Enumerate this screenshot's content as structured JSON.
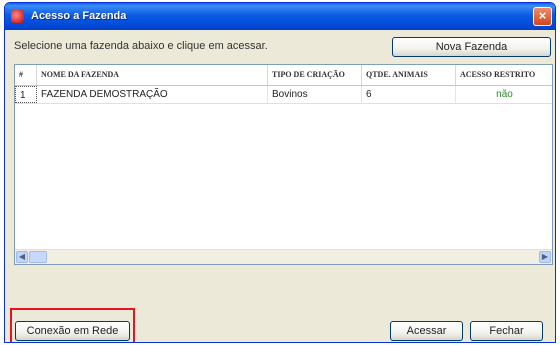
{
  "window": {
    "title": "Acesso a Fazenda",
    "close_label": "×"
  },
  "main": {
    "instruction": "Selecione uma fazenda abaixo e clique em acessar.",
    "new_farm_button": "Nova Fazenda"
  },
  "table": {
    "headers": [
      "#",
      "NOME DA FAZENDA",
      "TIPO DE CRIAÇÃO",
      "QTDE. ANIMAIS",
      "ACESSO RESTRITO"
    ],
    "rows": [
      [
        "1",
        "FAZENDA DEMOSTRAÇÃO",
        "Bovinos",
        "6",
        "não"
      ]
    ]
  },
  "footer": {
    "network_button": "Conexão em Rede",
    "access_button": "Acessar",
    "close_button": "Fechar"
  },
  "colors": {
    "titlebar": "#0a5ce3",
    "highlight": "#e8141e",
    "restricted_value": "#2a8a2a"
  },
  "icons": {
    "app": "app-icon",
    "close": "close-icon",
    "scroll_left": "arrow-left-icon",
    "scroll_right": "arrow-right-icon"
  }
}
